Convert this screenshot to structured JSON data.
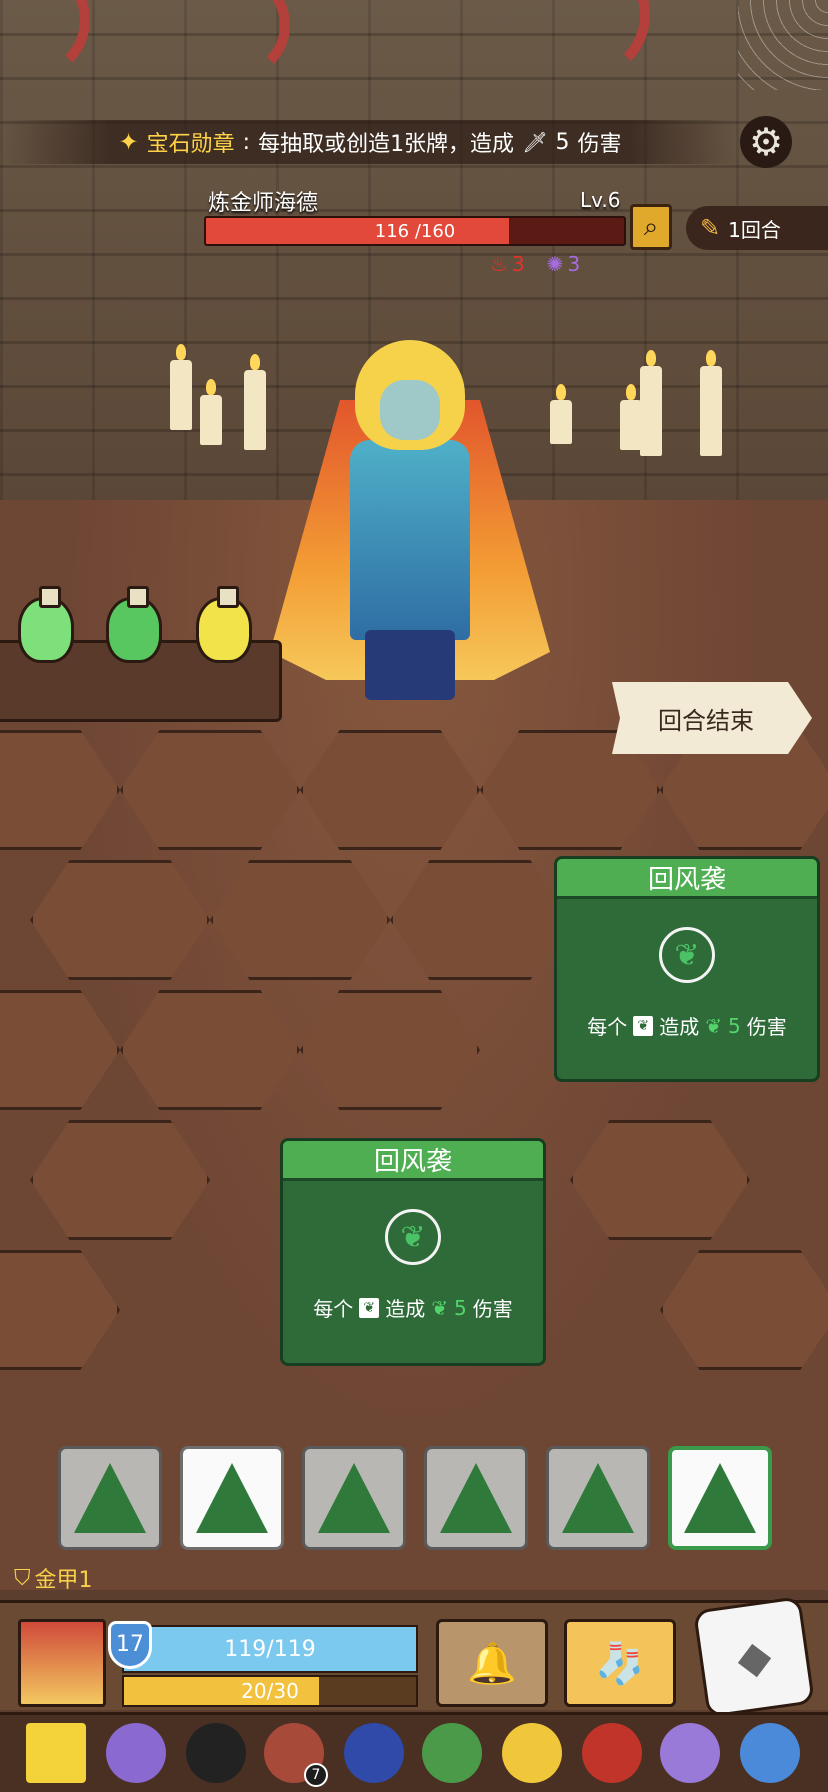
{
  "medal": {
    "icon": "gem-medal-icon",
    "name": "宝石勋章",
    "colon": ":",
    "desc_prefix": "每抽取或创造1张牌，造成",
    "damage_icon": "sword-icon",
    "damage_value": "5",
    "damage_suffix": "伤害"
  },
  "settings": {
    "icon": "gear-icon"
  },
  "enemy": {
    "name": "炼金师海德",
    "level": "Lv.6",
    "hp_current": 116,
    "hp_max": 160,
    "hp_text": "116 /160",
    "status": [
      {
        "icon": "fire-icon",
        "value": "3",
        "color": "#e4332b"
      },
      {
        "icon": "spark-icon",
        "value": "3",
        "color": "#a56ce0"
      }
    ]
  },
  "turn": {
    "icon": "scroll-icon",
    "label": "1回合"
  },
  "end_turn_label": "回合结束",
  "cards": [
    {
      "title": "回风袭",
      "emblem": "leaf-icon",
      "desc_each": "每个",
      "desc_deal": "造成",
      "amount": "5",
      "desc_damage": "伤害"
    },
    {
      "title": "回风袭",
      "emblem": "leaf-icon",
      "desc_each": "每个",
      "desc_deal": "造成",
      "amount": "5",
      "desc_damage": "伤害"
    }
  ],
  "dice": [
    {
      "face": "tree-icon",
      "state": "normal"
    },
    {
      "face": "tree-icon",
      "state": "selected"
    },
    {
      "face": "tree-icon",
      "state": "normal"
    },
    {
      "face": "tree-icon",
      "state": "normal"
    },
    {
      "face": "tree-icon",
      "state": "normal"
    },
    {
      "face": "tree-icon",
      "state": "highlight"
    }
  ],
  "armor": {
    "icon": "shield-icon",
    "label": "金甲1"
  },
  "player": {
    "level": "17",
    "hp_text": "119/119",
    "hp_current": 119,
    "hp_max": 119,
    "energy_text": "20/30",
    "energy_current": 20,
    "energy_max": 30
  },
  "items": [
    {
      "icon": "bells-icon"
    },
    {
      "icon": "stocking-icon"
    }
  ],
  "relics": [
    {
      "icon": "yellow-triangle-icon",
      "color": "#f4d23a"
    },
    {
      "icon": "purple-shield-icon",
      "color": "#8a6ad0"
    },
    {
      "icon": "top-hat-icon",
      "color": "#222"
    },
    {
      "icon": "button-icon",
      "color": "#a84a3a",
      "badge": "7"
    },
    {
      "icon": "blue-cloak-icon",
      "color": "#2f4aa8"
    },
    {
      "icon": "turtle-shell-icon",
      "color": "#4a9a4a"
    },
    {
      "icon": "gold-crown-icon",
      "color": "#f0c63a"
    },
    {
      "icon": "red-cauldron-icon",
      "color": "#c0342a"
    },
    {
      "icon": "purple-boot-icon",
      "color": "#9a7ad8"
    },
    {
      "icon": "blue-egg-icon",
      "color": "#4a8ad8"
    }
  ]
}
